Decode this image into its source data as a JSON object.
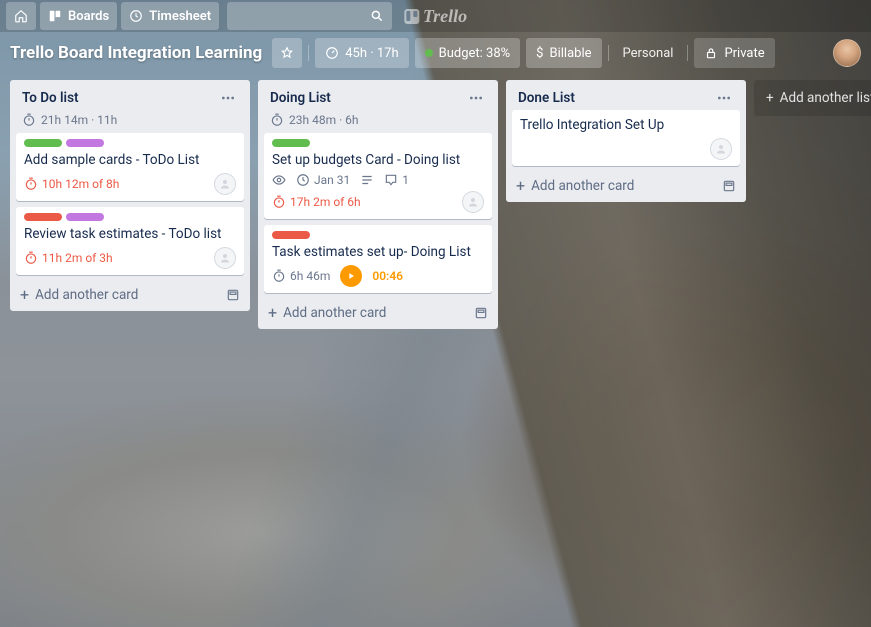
{
  "nav": {
    "boards": "Boards",
    "timesheet": "Timesheet",
    "brand": "Trello"
  },
  "header": {
    "title": "Trello Board Integration Learning",
    "time_summary": "45h · 17h",
    "budget": "Budget: 38%",
    "billable": "Billable",
    "visibility_personal": "Personal",
    "visibility_private": "Private",
    "dollar": "$"
  },
  "lists": [
    {
      "title": "To Do list",
      "meta": "21h 14m · 11h",
      "cards": [
        {
          "labels": [
            "green",
            "purple"
          ],
          "title": "Add sample cards - ToDo List",
          "badges": [
            {
              "type": "timer-red",
              "text": "10h 12m of 8h"
            }
          ],
          "member": "plain"
        },
        {
          "labels": [
            "red",
            "purple"
          ],
          "title": "Review task estimates - ToDo list",
          "badges": [
            {
              "type": "timer-red",
              "text": "11h 2m of 3h"
            }
          ],
          "member": "plain"
        }
      ],
      "add": "Add another card"
    },
    {
      "title": "Doing List",
      "meta": "23h 48m · 6h",
      "cards": [
        {
          "labels": [
            "green"
          ],
          "title": "Set up budgets Card - Doing list",
          "badges": [
            {
              "type": "eye"
            },
            {
              "type": "date",
              "text": "Jan 31"
            },
            {
              "type": "desc"
            },
            {
              "type": "comment",
              "text": "1"
            }
          ],
          "secondrow": [
            {
              "type": "timer-red",
              "text": "17h 2m of 6h"
            }
          ],
          "member": "plain"
        },
        {
          "labels": [
            "red"
          ],
          "title": "Task estimates set up- Doing List",
          "badges": [
            {
              "type": "timer-plain",
              "text": "6h 46m"
            },
            {
              "type": "running",
              "text": "00:46"
            }
          ]
        }
      ],
      "add": "Add another card"
    },
    {
      "title": "Done List",
      "meta": "",
      "cards": [
        {
          "labels": [],
          "title": "Trello Integration Set Up",
          "badges": [],
          "member": "plain-only"
        }
      ],
      "add": "Add another card"
    }
  ],
  "add_list": "Add another list"
}
